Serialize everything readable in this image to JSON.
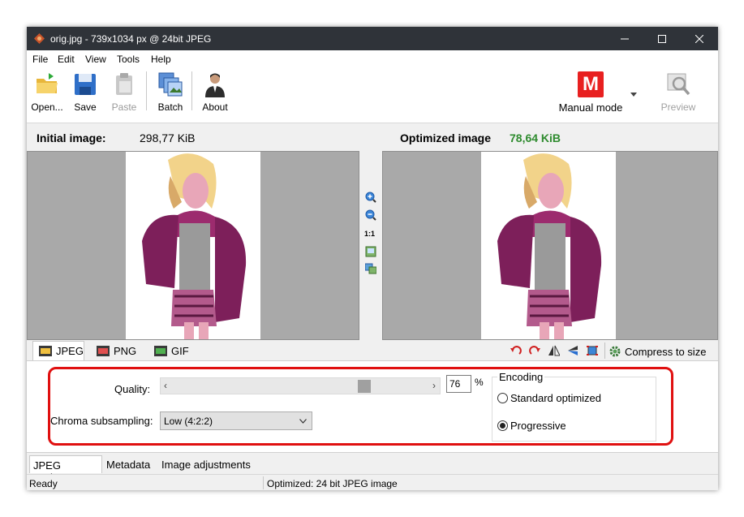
{
  "window": {
    "title": "orig.jpg - 739x1034 px @ 24bit JPEG"
  },
  "menu": [
    "File",
    "Edit",
    "View",
    "Tools",
    "Help"
  ],
  "toolbar": {
    "open": "Open...",
    "save": "Save",
    "paste": "Paste",
    "batch": "Batch",
    "about": "About",
    "mode_badge": "M",
    "mode_label": "Manual mode",
    "preview": "Preview"
  },
  "headers": {
    "initial_label": "Initial image:",
    "initial_size": "298,77 KiB",
    "optimized_label": "Optimized image",
    "optimized_size": "78,64 KiB",
    "optimized_color": "#2e8b2e"
  },
  "zoom": {
    "one_to_one": "1:1"
  },
  "format_tabs": {
    "jpeg": "JPEG",
    "png": "PNG",
    "gif": "GIF",
    "compress": "Compress to size"
  },
  "options": {
    "quality_label": "Quality:",
    "quality_value": "76",
    "quality_fraction": 0.76,
    "percent": "%",
    "chroma_label": "Chroma subsampling:",
    "chroma_value": "Low (4:2:2)",
    "encoding_title": "Encoding",
    "encoding_standard": "Standard optimized",
    "encoding_progressive": "Progressive",
    "encoding_selected": "progressive"
  },
  "bottom_tabs": [
    "JPEG Options",
    "Metadata",
    "Image adjustments"
  ],
  "status": {
    "left": "Ready",
    "right": "Optimized: 24 bit JPEG image"
  },
  "colors": {
    "highlight": "#e01010",
    "mode_badge": "#e82020"
  }
}
